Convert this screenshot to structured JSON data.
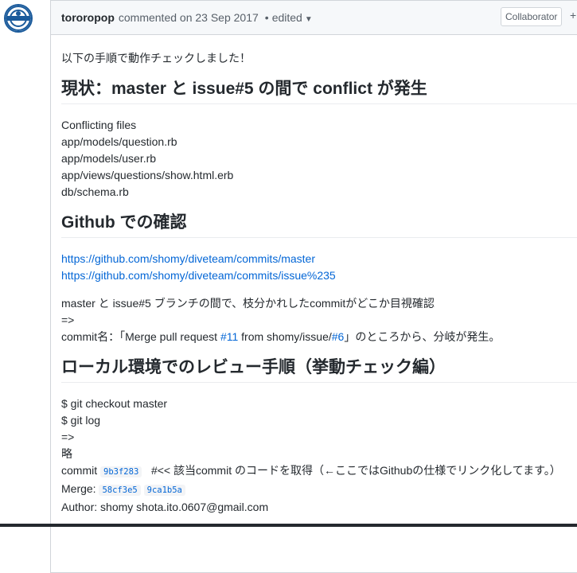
{
  "header": {
    "author": "tororopop",
    "commented_on": "commented on 23 Sep 2017",
    "separator": "•",
    "edited_label": "edited",
    "role_badge": "Collaborator",
    "reaction_label": "+"
  },
  "body": {
    "intro": "以下の手順で動作チェックしました！",
    "section1": {
      "heading": "現状：master と issue#5 の間で conflict が発生",
      "lines": [
        "Conflicting files",
        "app/models/question.rb",
        "app/models/user.rb",
        "app/views/questions/show.html.erb",
        "db/schema.rb"
      ]
    },
    "section2": {
      "heading": "Github での確認",
      "links": [
        "https://github.com/shomy/diveteam/commits/master",
        "https://github.com/shomy/diveteam/commits/issue%235"
      ],
      "text1": "master と issue#5 ブランチの間で、枝分かれしたcommitがどこか目視確認",
      "text2": "=>",
      "commit_prefix": "commit名：「Merge pull request ",
      "pr_link": "#11",
      "commit_middle": " from shomy/issue/",
      "issue_link": "#6",
      "commit_suffix": "」のところから、分岐が発生。"
    },
    "section3": {
      "heading": "ローカル環境でのレビュー手順（挙動チェック編）",
      "lines": [
        "$ git checkout master",
        "$ git log",
        "=>",
        "略"
      ],
      "commit_label": "commit",
      "commit_sha": "9b3f283",
      "commit_comment": "#<< 該当commit のコードを取得（←ここではGithubの仕様でリンク化してます。）",
      "merge_label": "Merge:",
      "merge_sha1": "58cf3e5",
      "merge_sha2": "9ca1b5a",
      "author_line": "Author: shomy shota.ito.0607@gmail.com"
    }
  },
  "colors": {
    "link": "#0366d6",
    "header_bg": "#f6f8fa",
    "border": "#d1d5da",
    "text": "#24292e",
    "muted": "#586069"
  }
}
